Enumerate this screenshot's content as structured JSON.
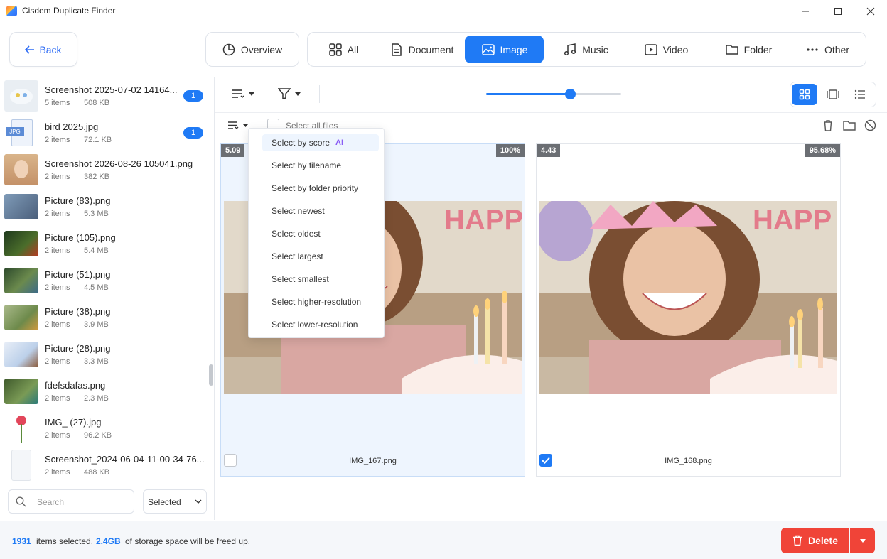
{
  "window": {
    "title": "Cisdem Duplicate Finder"
  },
  "nav": {
    "back_label": "Back",
    "overview_label": "Overview",
    "tabs": [
      {
        "label": "All",
        "icon": "grid-icon"
      },
      {
        "label": "Document",
        "icon": "document-icon"
      },
      {
        "label": "Image",
        "icon": "image-icon",
        "active": true
      },
      {
        "label": "Music",
        "icon": "music-icon"
      },
      {
        "label": "Video",
        "icon": "video-icon"
      },
      {
        "label": "Folder",
        "icon": "folder-icon"
      },
      {
        "label": "Other",
        "icon": "more-icon"
      }
    ]
  },
  "sidebar": {
    "groups": [
      {
        "name": "Screenshot 2025-07-02 14164...",
        "count": "5 items",
        "size": "508 KB",
        "badge": "1"
      },
      {
        "name": "bird 2025.jpg",
        "count": "2 items",
        "size": "72.1 KB",
        "badge": "1"
      },
      {
        "name": "Screenshot 2026-08-26 105041.png",
        "count": "2 items",
        "size": "382 KB"
      },
      {
        "name": "Picture (83).png",
        "count": "2 items",
        "size": "5.3 MB"
      },
      {
        "name": "Picture (105).png",
        "count": "2 items",
        "size": "5.4 MB"
      },
      {
        "name": "Picture (51).png",
        "count": "2 items",
        "size": "4.5 MB"
      },
      {
        "name": "Picture (38).png",
        "count": "2 items",
        "size": "3.9 MB"
      },
      {
        "name": "Picture (28).png",
        "count": "2 items",
        "size": "3.3 MB"
      },
      {
        "name": "fdefsdafas.png",
        "count": "2 items",
        "size": "2.3 MB"
      },
      {
        "name": "IMG_ (27).jpg",
        "count": "2 items",
        "size": "96.2 KB"
      },
      {
        "name": "Screenshot_2024-06-04-11-00-34-76...",
        "count": "2 items",
        "size": "488 KB"
      }
    ],
    "search_placeholder": "Search",
    "filter_value": "Selected"
  },
  "toolbar": {
    "zoom_level": 0.62,
    "select_all_label": "Select all files"
  },
  "select_menu": {
    "items": [
      {
        "label": "Select by score",
        "badge": "AI"
      },
      {
        "label": "Select by filename"
      },
      {
        "label": "Select by folder priority"
      },
      {
        "label": "Select newest"
      },
      {
        "label": "Select oldest"
      },
      {
        "label": "Select largest"
      },
      {
        "label": "Select smallest"
      },
      {
        "label": "Select higher-resolution"
      },
      {
        "label": "Select lower-resolution"
      }
    ]
  },
  "cards": [
    {
      "score": "5.09",
      "similarity": "100%",
      "filename": "IMG_167.png",
      "checked": false
    },
    {
      "score": "4.43",
      "similarity": "95.68%",
      "filename": "IMG_168.png",
      "checked": true
    }
  ],
  "footer": {
    "selected_count": "1931",
    "selected_text": "items selected.",
    "freed_size": "2.4GB",
    "freed_text": "of storage space will be freed up.",
    "delete_label": "Delete"
  },
  "colors": {
    "accent": "#1f7af5",
    "danger": "#f04438"
  }
}
